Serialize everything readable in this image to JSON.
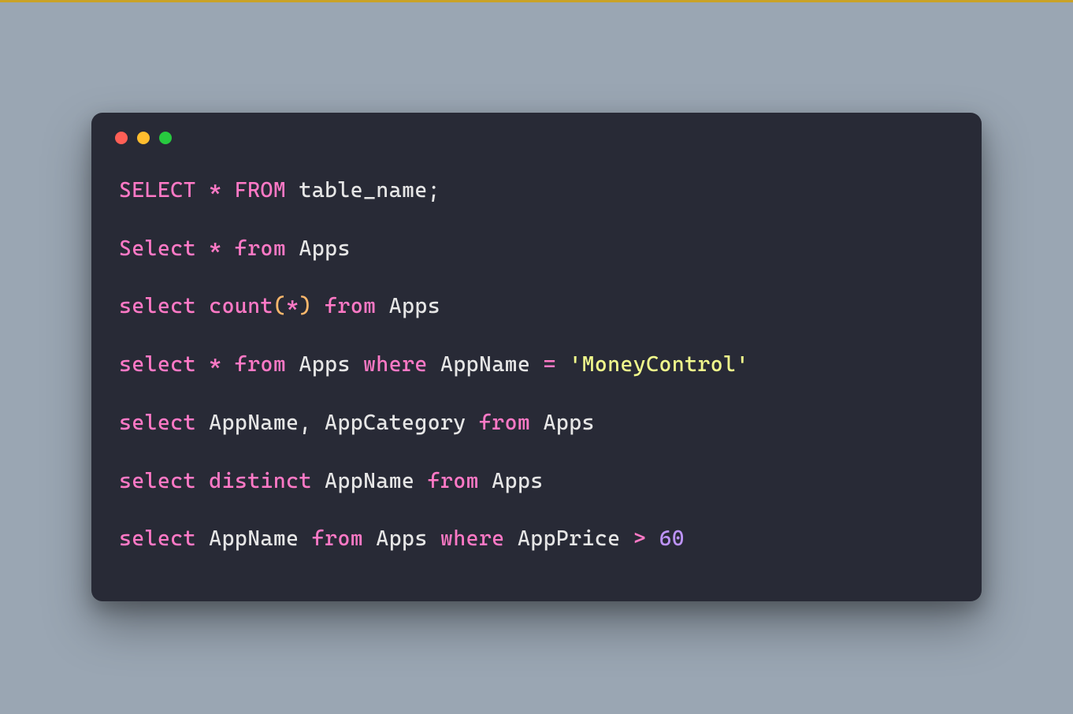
{
  "syntax": {
    "keyword": "#ff79c6",
    "identifier": "#e6e6e6",
    "punctuation": "#e6e6e6",
    "paren": "#ffb86c",
    "string": "#f1fa8c",
    "number": "#bd93f9"
  },
  "code": {
    "lines": [
      {
        "tokens": [
          {
            "t": "SELECT",
            "c": "kw"
          },
          {
            "t": " ",
            "c": "id"
          },
          {
            "t": "*",
            "c": "kw"
          },
          {
            "t": " ",
            "c": "id"
          },
          {
            "t": "FROM",
            "c": "kw"
          },
          {
            "t": " table_name;",
            "c": "id"
          }
        ]
      },
      {
        "tokens": [
          {
            "t": "Select",
            "c": "kw"
          },
          {
            "t": " ",
            "c": "id"
          },
          {
            "t": "*",
            "c": "kw"
          },
          {
            "t": " ",
            "c": "id"
          },
          {
            "t": "from",
            "c": "kw"
          },
          {
            "t": " Apps",
            "c": "id"
          }
        ]
      },
      {
        "tokens": [
          {
            "t": "select",
            "c": "kw"
          },
          {
            "t": " ",
            "c": "id"
          },
          {
            "t": "count",
            "c": "kw"
          },
          {
            "t": "(",
            "c": "paren"
          },
          {
            "t": "*",
            "c": "kw"
          },
          {
            "t": ")",
            "c": "paren"
          },
          {
            "t": " ",
            "c": "id"
          },
          {
            "t": "from",
            "c": "kw"
          },
          {
            "t": " Apps",
            "c": "id"
          }
        ]
      },
      {
        "tokens": [
          {
            "t": "select",
            "c": "kw"
          },
          {
            "t": " ",
            "c": "id"
          },
          {
            "t": "*",
            "c": "kw"
          },
          {
            "t": " ",
            "c": "id"
          },
          {
            "t": "from",
            "c": "kw"
          },
          {
            "t": " Apps ",
            "c": "id"
          },
          {
            "t": "where",
            "c": "kw"
          },
          {
            "t": " AppName ",
            "c": "id"
          },
          {
            "t": "=",
            "c": "kw"
          },
          {
            "t": " ",
            "c": "id"
          },
          {
            "t": "'MoneyControl'",
            "c": "str"
          }
        ]
      },
      {
        "tokens": [
          {
            "t": "select",
            "c": "kw"
          },
          {
            "t": " AppName, AppCategory ",
            "c": "id"
          },
          {
            "t": "from",
            "c": "kw"
          },
          {
            "t": " Apps",
            "c": "id"
          }
        ]
      },
      {
        "tokens": [
          {
            "t": "select",
            "c": "kw"
          },
          {
            "t": " ",
            "c": "id"
          },
          {
            "t": "distinct",
            "c": "kw"
          },
          {
            "t": " AppName ",
            "c": "id"
          },
          {
            "t": "from",
            "c": "kw"
          },
          {
            "t": " Apps",
            "c": "id"
          }
        ]
      },
      {
        "tokens": [
          {
            "t": "select",
            "c": "kw"
          },
          {
            "t": " AppName ",
            "c": "id"
          },
          {
            "t": "from",
            "c": "kw"
          },
          {
            "t": " Apps ",
            "c": "id"
          },
          {
            "t": "where",
            "c": "kw"
          },
          {
            "t": " AppPrice ",
            "c": "id"
          },
          {
            "t": ">",
            "c": "kw"
          },
          {
            "t": " ",
            "c": "id"
          },
          {
            "t": "60",
            "c": "num"
          }
        ]
      }
    ]
  }
}
